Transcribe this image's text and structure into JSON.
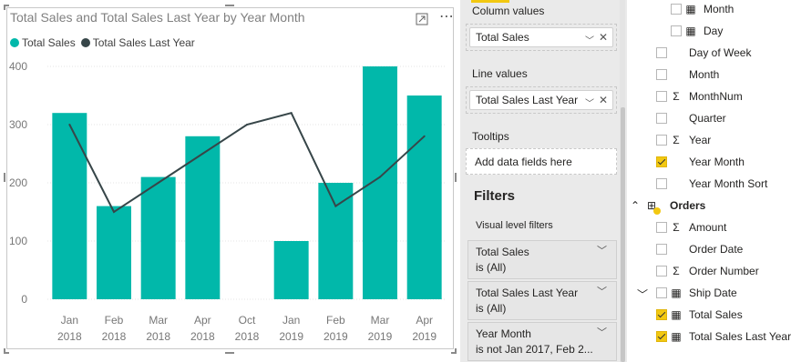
{
  "visual": {
    "title": "Total Sales and Total Sales Last Year by Year Month",
    "legend": [
      {
        "label": "Total Sales",
        "color": "#01b8aa"
      },
      {
        "label": "Total Sales Last Year",
        "color": "#374649"
      }
    ]
  },
  "chart_data": {
    "type": "bar",
    "categories": [
      [
        "Jan",
        "2018"
      ],
      [
        "Feb",
        "2018"
      ],
      [
        "Mar",
        "2018"
      ],
      [
        "Apr",
        "2018"
      ],
      [
        "Oct",
        "2018"
      ],
      [
        "Jan",
        "2019"
      ],
      [
        "Feb",
        "2019"
      ],
      [
        "Mar",
        "2019"
      ],
      [
        "Apr",
        "2019"
      ]
    ],
    "series": [
      {
        "name": "Total Sales",
        "kind": "bar",
        "color": "#01b8aa",
        "values": [
          320,
          160,
          210,
          280,
          null,
          100,
          200,
          400,
          350
        ]
      },
      {
        "name": "Total Sales Last Year",
        "kind": "line",
        "color": "#374649",
        "values": [
          300,
          150,
          200,
          250,
          300,
          320,
          160,
          210,
          280
        ]
      }
    ],
    "yticks": [
      0,
      100,
      200,
      300,
      400
    ],
    "ylim": [
      0,
      400
    ],
    "grid": true,
    "legend_position": "top-left"
  },
  "fields_pane": {
    "column_values_label": "Column values",
    "column_value": "Total Sales",
    "line_values_label": "Line values",
    "line_value": "Total Sales Last Year",
    "tooltips_label": "Tooltips",
    "tooltips_placeholder": "Add data fields here",
    "filters_title": "Filters",
    "visual_level_label": "Visual level filters",
    "filters": [
      {
        "field": "Total Sales",
        "state": "is (All)"
      },
      {
        "field": "Total Sales Last Year",
        "state": "is (All)"
      },
      {
        "field": "Year Month",
        "state": "is not Jan 2017, Feb 2..."
      }
    ]
  },
  "field_list": [
    {
      "label": "Month",
      "icon": "calendar-icon",
      "checked": false,
      "indent": 2
    },
    {
      "label": "Day",
      "icon": "calendar-icon",
      "checked": false,
      "indent": 2
    },
    {
      "label": "Day of Week",
      "icon": "",
      "checked": false,
      "indent": 1
    },
    {
      "label": "Month",
      "icon": "",
      "checked": false,
      "indent": 1
    },
    {
      "label": "MonthNum",
      "icon": "sigma-icon",
      "checked": false,
      "indent": 1
    },
    {
      "label": "Quarter",
      "icon": "",
      "checked": false,
      "indent": 1
    },
    {
      "label": "Year",
      "icon": "sigma-icon",
      "checked": false,
      "indent": 1
    },
    {
      "label": "Year Month",
      "icon": "",
      "checked": true,
      "indent": 1
    },
    {
      "label": "Year Month Sort",
      "icon": "",
      "checked": false,
      "indent": 1
    },
    {
      "label": "Orders",
      "icon": "table-icon",
      "checked": false,
      "indent": 0,
      "group": true
    },
    {
      "label": "Amount",
      "icon": "sigma-icon",
      "checked": false,
      "indent": 1
    },
    {
      "label": "Order Date",
      "icon": "",
      "checked": false,
      "indent": 1
    },
    {
      "label": "Order Number",
      "icon": "sigma-icon",
      "checked": false,
      "indent": 1
    },
    {
      "label": "Ship Date",
      "icon": "calendar-icon",
      "checked": false,
      "indent": 1,
      "expandable": true
    },
    {
      "label": "Total Sales",
      "icon": "calculator-icon",
      "checked": true,
      "indent": 1
    },
    {
      "label": "Total Sales Last Year",
      "icon": "calculator-icon",
      "checked": true,
      "indent": 1
    }
  ]
}
